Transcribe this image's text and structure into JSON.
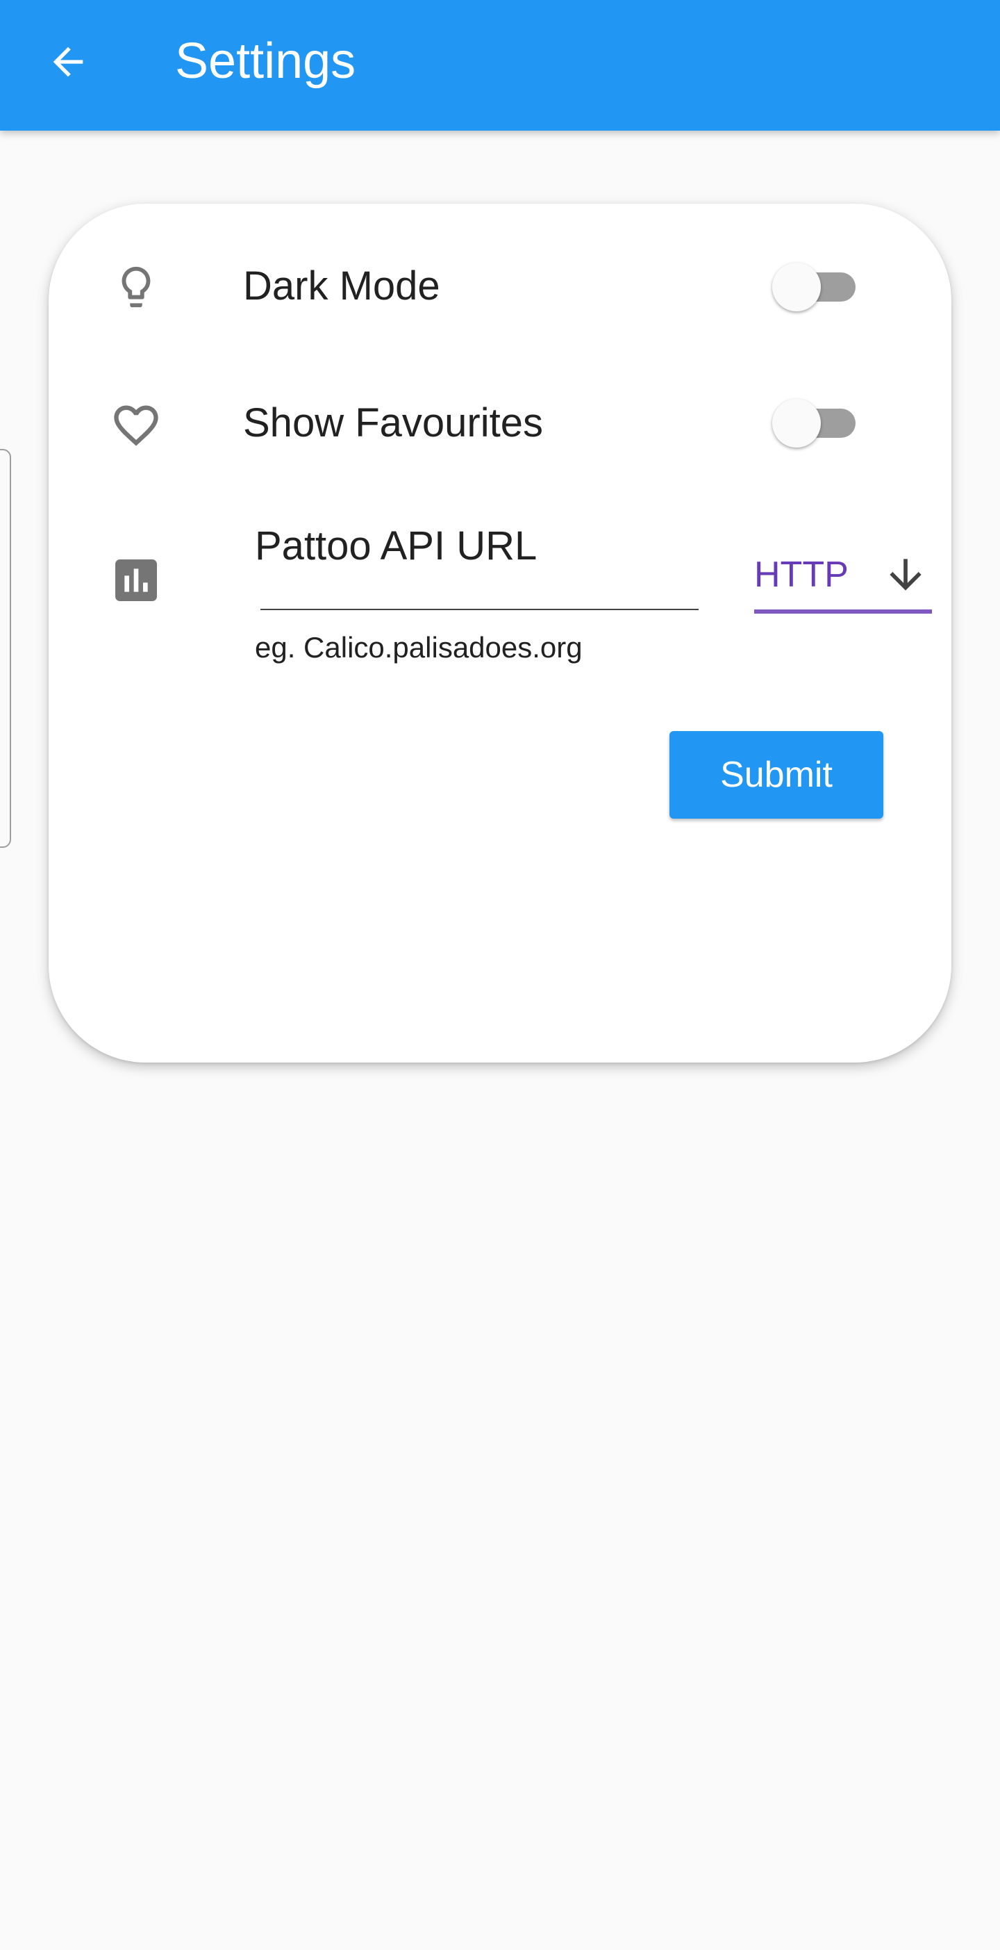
{
  "app_bar": {
    "title": "Settings",
    "back_icon": "arrow-back-icon",
    "background_color": "#2196f3"
  },
  "settings": {
    "dark_mode": {
      "label": "Dark Mode",
      "icon": "lightbulb-icon",
      "enabled": false
    },
    "show_favourites": {
      "label": "Show Favourites",
      "icon": "heart-icon",
      "enabled": false
    },
    "api_url": {
      "icon": "bar-chart-icon",
      "value": "Pattoo API URL",
      "helper": "eg. Calico.palisadoes.org",
      "protocol": "HTTP",
      "protocol_icon": "arrow-down-icon",
      "protocol_color": "#673ab7"
    },
    "submit_label": "Submit"
  }
}
